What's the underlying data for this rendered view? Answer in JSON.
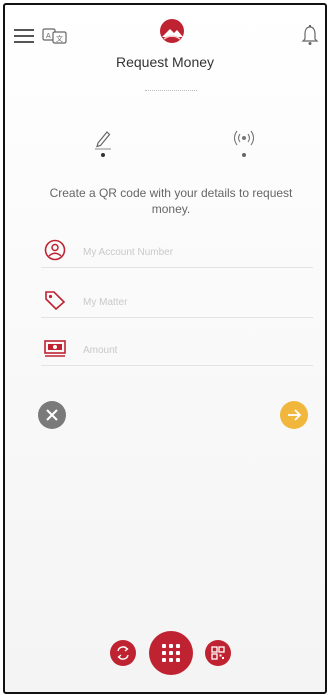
{
  "header": {
    "title": "Request Money",
    "menu_icon": "hamburger-menu-icon",
    "language_icon": "language-translate-icon",
    "logo": "bank-logo",
    "notification_icon": "bell-icon"
  },
  "tabs": [
    {
      "name": "manual-entry",
      "icon": "pencil-icon",
      "selected": true
    },
    {
      "name": "nfc-contactless",
      "icon": "contactless-icon",
      "selected": false
    }
  ],
  "instructions": "Create a QR code with your details to request money.",
  "form": {
    "account_placeholder": "My Account Number",
    "tag_placeholder": "My Matter",
    "amount_placeholder": "Amount"
  },
  "actions": {
    "cancel_icon": "close-icon",
    "next_icon": "arrow-right-icon"
  },
  "bottom_nav": [
    {
      "name": "transfer",
      "icon": "transfer-arrows-icon"
    },
    {
      "name": "menu",
      "icon": "grid-icon"
    },
    {
      "name": "qr",
      "icon": "qr-code-icon"
    }
  ],
  "colors": {
    "brand_red": "#bf2332",
    "accent_yellow": "#f1b73c",
    "muted_gray": "#7a7a7a"
  }
}
